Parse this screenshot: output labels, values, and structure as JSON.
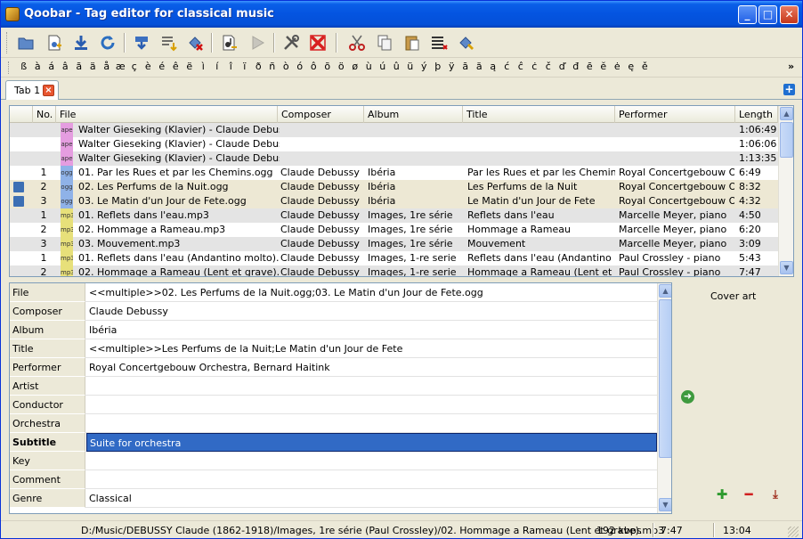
{
  "window": {
    "title": "Qoobar - Tag editor for classical music"
  },
  "window_controls": {
    "minimize": "_",
    "maximize": "□",
    "close": "✕"
  },
  "toolbar": {
    "buttons": [
      "open-folder",
      "add-files",
      "save",
      "reload",
      "import",
      "export",
      "remove-tags",
      "play-file",
      "play",
      "settings",
      "fullscreen",
      "cut",
      "copy",
      "paste",
      "remove-fields",
      "batch-edit"
    ]
  },
  "charbar": {
    "chars": [
      "ß",
      "à",
      "á",
      "â",
      "ã",
      "ä",
      "å",
      "æ",
      "ç",
      "è",
      "é",
      "ê",
      "ë",
      "ì",
      "í",
      "î",
      "ï",
      "ð",
      "ñ",
      "ò",
      "ó",
      "ô",
      "õ",
      "ö",
      "ø",
      "ù",
      "ú",
      "û",
      "ü",
      "ý",
      "þ",
      "ÿ",
      "ā",
      "ă",
      "ą",
      "ć",
      "ĉ",
      "ċ",
      "č",
      "ď",
      "đ",
      "ē",
      "ĕ",
      "ė",
      "ę",
      "ě"
    ],
    "more": "»"
  },
  "tabs": [
    {
      "label": "Tab 1",
      "close": "×"
    }
  ],
  "tab_add": "+",
  "filelist": {
    "columns": [
      "No.",
      "File",
      "Composer",
      "Album",
      "Title",
      "Performer",
      "Length"
    ],
    "rows": [
      {
        "no": "",
        "type": "ape",
        "file": "Walter Gieseking (Klavier) - Claude Debussy...",
        "composer": "",
        "album": "",
        "title": "",
        "performer": "",
        "length": "1:06:49",
        "style": "gray",
        "saved": false
      },
      {
        "no": "",
        "type": "ape",
        "file": "Walter Gieseking (Klavier) - Claude Debussy...",
        "composer": "",
        "album": "",
        "title": "",
        "performer": "",
        "length": "1:06:06",
        "style": "white",
        "saved": false
      },
      {
        "no": "",
        "type": "ape",
        "file": "Walter Gieseking (Klavier) - Claude Debussy...",
        "composer": "",
        "album": "",
        "title": "",
        "performer": "",
        "length": "1:13:35",
        "style": "gray",
        "saved": false
      },
      {
        "no": "1",
        "type": "ogg",
        "file": "01. Par les Rues et par les Chemins.ogg",
        "composer": "Claude Debussy",
        "album": "Ibéria",
        "title": "Par les Rues et par les Chemins",
        "performer": "Royal Concertgebouw O...",
        "length": "6:49",
        "style": "white",
        "saved": false
      },
      {
        "no": "2",
        "type": "ogg",
        "file": "02. Les Perfums de la Nuit.ogg",
        "composer": "Claude Debussy",
        "album": "Ibéria",
        "title": "Les Perfums de la Nuit",
        "performer": "Royal Concertgebouw O...",
        "length": "8:32",
        "style": "sel",
        "saved": true
      },
      {
        "no": "3",
        "type": "ogg",
        "file": "03. Le Matin d'un Jour de Fete.ogg",
        "composer": "Claude Debussy",
        "album": "Ibéria",
        "title": "Le Matin d'un Jour de Fete",
        "performer": "Royal Concertgebouw O...",
        "length": "4:32",
        "style": "sel",
        "saved": true
      },
      {
        "no": "1",
        "type": "mp3",
        "file": "01. Reflets dans l'eau.mp3",
        "composer": "Claude Debussy",
        "album": "Images, 1re série",
        "title": "Reflets dans l'eau",
        "performer": "Marcelle Meyer, piano",
        "length": "4:50",
        "style": "gray",
        "saved": false
      },
      {
        "no": "2",
        "type": "mp3",
        "file": "02. Hommage a Rameau.mp3",
        "composer": "Claude Debussy",
        "album": "Images, 1re série",
        "title": "Hommage a Rameau",
        "performer": "Marcelle Meyer, piano",
        "length": "6:20",
        "style": "white",
        "saved": false
      },
      {
        "no": "3",
        "type": "mp3",
        "file": "03. Mouvement.mp3",
        "composer": "Claude Debussy",
        "album": "Images, 1re série",
        "title": "Mouvement",
        "performer": "Marcelle Meyer, piano",
        "length": "3:09",
        "style": "gray",
        "saved": false
      },
      {
        "no": "1",
        "type": "mp3",
        "file": "01. Reflets dans l'eau (Andantino molto).mp3",
        "composer": "Claude Debussy",
        "album": "Images, 1-re serie",
        "title": "Reflets dans l'eau (Andantino m...",
        "performer": "Paul Crossley - piano",
        "length": "5:43",
        "style": "white",
        "saved": false
      },
      {
        "no": "2",
        "type": "mp3",
        "file": "02. Hommage a Rameau (Lent et grave).mp3",
        "composer": "Claude Debussy",
        "album": "Images, 1-re serie",
        "title": "Hommage a Rameau (Lent et gr...",
        "performer": "Paul Crossley - piano",
        "length": "7:47",
        "style": "gray",
        "saved": false
      }
    ]
  },
  "props": [
    {
      "label": "File",
      "value": "<<multiple>>02. Les Perfums de la Nuit.ogg;03. Le Matin d'un Jour de Fete.ogg"
    },
    {
      "label": "Composer",
      "value": "Claude Debussy"
    },
    {
      "label": "Album",
      "value": "Ibéria"
    },
    {
      "label": "Title",
      "value": "<<multiple>>Les Perfums de la Nuit;Le Matin d'un Jour de Fete"
    },
    {
      "label": "Performer",
      "value": "Royal Concertgebouw Orchestra, Bernard Haitink"
    },
    {
      "label": "Artist",
      "value": ""
    },
    {
      "label": "Conductor",
      "value": ""
    },
    {
      "label": "Orchestra",
      "value": ""
    },
    {
      "label": "Subtitle",
      "value": "Suite for orchestra",
      "selected": true
    },
    {
      "label": "Key",
      "value": ""
    },
    {
      "label": "Comment",
      "value": ""
    },
    {
      "label": "Genre",
      "value": "Classical"
    }
  ],
  "cover": {
    "title": "Cover art"
  },
  "status": {
    "path": "D:/Music/DEBUSSY Claude (1862-1918)/Images, 1re série (Paul Crossley)/02. Hommage a Rameau (Lent et grave).mp3",
    "bitrate": "192 kbps",
    "length": "7:47",
    "total": "13:04"
  },
  "colors": {
    "titlebar": "#0454e0",
    "selection": "#316ac5",
    "window_bg": "#ece9d8"
  }
}
